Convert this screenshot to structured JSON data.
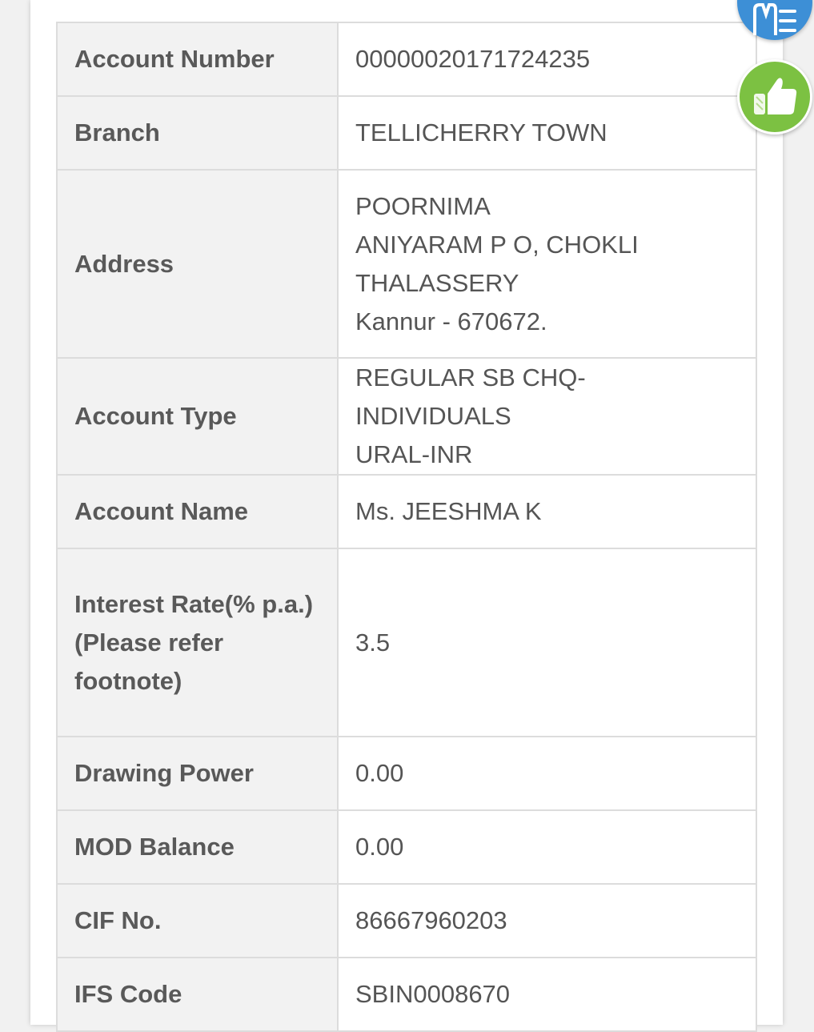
{
  "account_details": {
    "rows": [
      {
        "label": "Account Number",
        "value": "00000020171724235"
      },
      {
        "label": "Branch",
        "value": "TELLICHERRY TOWN"
      },
      {
        "label": "Address",
        "value": "POORNIMA\nANIYARAM P O, CHOKLI\nTHALASSERY\nKannur  - 670672."
      },
      {
        "label": "Account Type",
        "value": "REGULAR SB CHQ-INDIVIDUALS\nURAL-INR"
      },
      {
        "label": "Account Name",
        "value": "Ms. JEESHMA K"
      },
      {
        "label": "Interest Rate(% p.a.)\n(Please refer footnote)",
        "value": "3.5"
      },
      {
        "label": "Drawing Power",
        "value": "0.00"
      },
      {
        "label": "MOD Balance",
        "value": "0.00"
      },
      {
        "label": "CIF No.",
        "value": "86667960203"
      },
      {
        "label": "IFS Code",
        "value": "SBIN0008670"
      }
    ]
  },
  "floating_buttons": {
    "menu_icon": "menu-icon",
    "like_icon": "thumbs-up-icon",
    "menu_color": "#3d8fd6",
    "like_color": "#7cc142"
  }
}
